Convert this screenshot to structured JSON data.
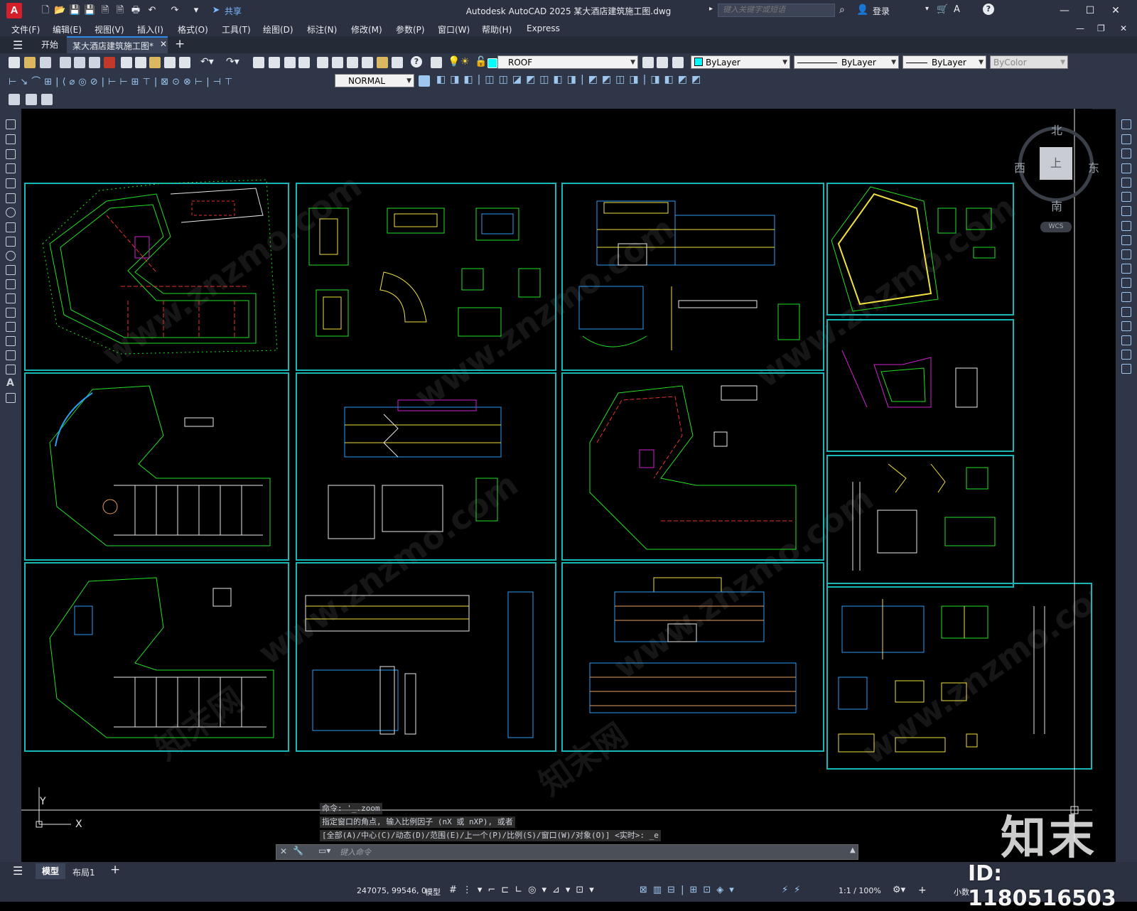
{
  "titlebar": {
    "app_logo": "A",
    "share_label": "共享",
    "title": "Autodesk AutoCAD 2025    某大酒店建筑施工图.dwg",
    "search_placeholder": "键入关键字或短语",
    "login_label": "登录",
    "minimize": "—",
    "maximize": "☐",
    "close": "✕"
  },
  "menu": [
    "文件(F)",
    "编辑(E)",
    "视图(V)",
    "插入(I)",
    "格式(O)",
    "工具(T)",
    "绘图(D)",
    "标注(N)",
    "修改(M)",
    "参数(P)",
    "窗口(W)",
    "帮助(H)",
    "Express"
  ],
  "tabs": {
    "start": "开始",
    "document": "某大酒店建筑施工图*",
    "add": "+"
  },
  "toolbar": {
    "layer": "ROOF",
    "color": "ByLayer",
    "linetype": "ByLayer",
    "lineweight": "ByLayer",
    "plotstyle": "ByColor",
    "textstyle": "NORMAL"
  },
  "compass": {
    "north": "北",
    "south": "南",
    "west": "西",
    "east": "东",
    "cube_face": "上",
    "wcs": "WCS"
  },
  "ucs": {
    "x": "X",
    "y": "Y"
  },
  "command": {
    "history": [
      "命令: '_.zoom",
      "指定窗口的角点, 输入比例因子 (nX 或 nXP), 或者",
      "[全部(A)/中心(C)/动态(D)/范围(E)/上一个(P)/比例(S)/窗口(W)/对象(O)] <实时>: _e"
    ],
    "placeholder": "键入命令"
  },
  "layout_tabs": {
    "model": "模型",
    "layout1": "布局1",
    "add": "+"
  },
  "status": {
    "coordinates": "247075, 99546, 0",
    "space": "模型",
    "scale": "1:1 / 100%",
    "units": "小数"
  },
  "watermarks": {
    "text": "www.znzmo.com",
    "text_cn": "知末网",
    "brand": "知末",
    "asset_id": "ID: 1180516503"
  },
  "colors": {
    "frame": "#18b7b7",
    "titlebar": "#2b3140",
    "toolbar": "#2f3647",
    "accent": "#2d8ae8"
  }
}
